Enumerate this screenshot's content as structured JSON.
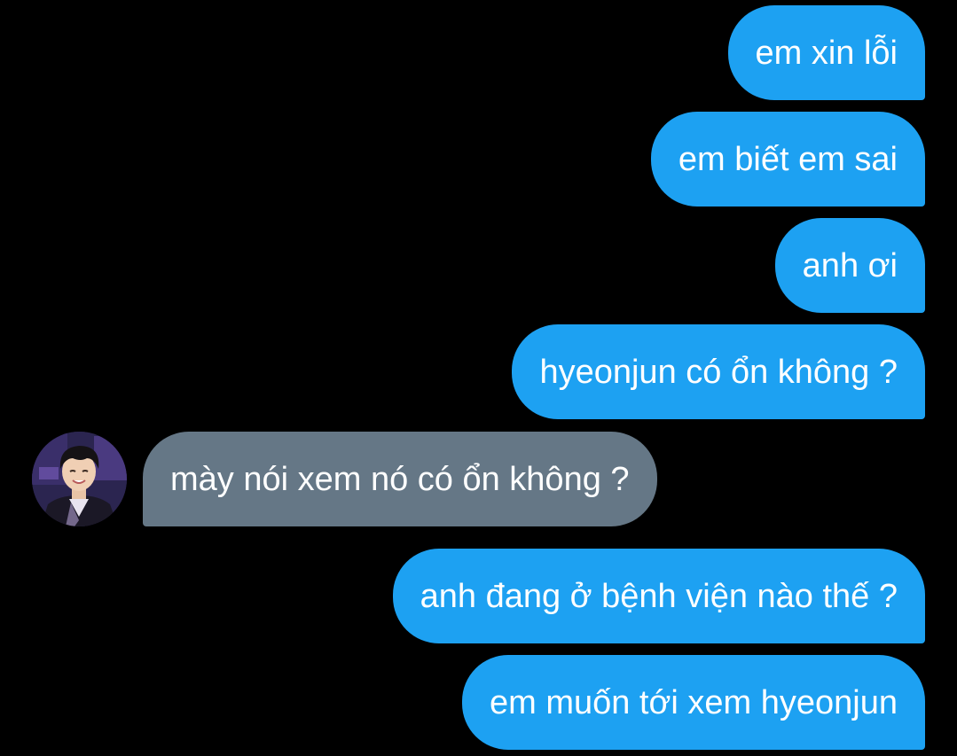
{
  "theme": {
    "background": "#000000",
    "sent_bubble_color": "#1da1f2",
    "received_bubble_color": "#657786",
    "text_color": "#ffffff"
  },
  "messages": [
    {
      "direction": "sent",
      "text": "em xin lỗi"
    },
    {
      "direction": "sent",
      "text": "em biết em sai"
    },
    {
      "direction": "sent",
      "text": "anh ơi"
    },
    {
      "direction": "sent",
      "text": "hyeonjun có ổn không ?"
    },
    {
      "direction": "received",
      "text": "mày nói xem nó có ổn không ?"
    },
    {
      "direction": "sent",
      "text": "anh đang ở bệnh viện nào thế ?"
    },
    {
      "direction": "sent",
      "text": "em muốn tới xem hyeonjun"
    }
  ],
  "avatar": {
    "icon": "profile-photo-avatar"
  }
}
